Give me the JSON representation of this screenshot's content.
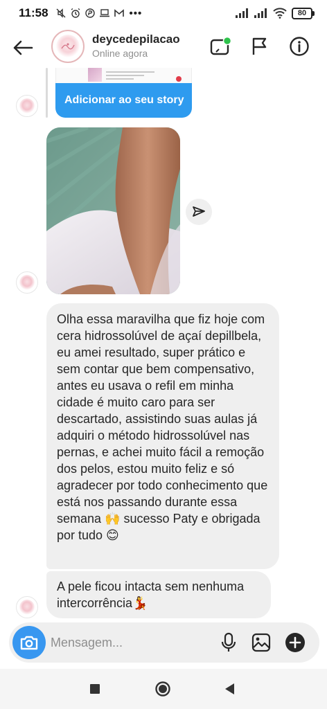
{
  "status_bar": {
    "time": "11:58",
    "overflow": "•••",
    "battery": "80"
  },
  "header": {
    "username": "deycedepilacao",
    "status": "Online agora",
    "icons": [
      "back-arrow-icon",
      "video-call-icon",
      "flag-icon",
      "info-icon"
    ]
  },
  "story_share": {
    "cta_label": "Adicionar ao seu story"
  },
  "messages": [
    {
      "type": "text",
      "text": "Olha essa maravilha que fiz hoje com cera hidrossolúvel de açaí depillbela, eu amei resultado, super prático e sem contar que bem compensativo, antes eu usava  o refil em minha cidade é muito caro para ser descartado, assistindo suas aulas já adquiri o método hidrossolúvel nas pernas, e achei muito fácil a remoção dos pelos, estou muito feliz e só agradecer por todo conhecimento que está nos passando durante essa semana 🙌 sucesso Paty e obrigada por tudo 😊"
    },
    {
      "type": "text",
      "text": "A pele ficou intacta sem nenhuma intercorrência💃"
    }
  ],
  "composer": {
    "placeholder": "Mensagem..."
  },
  "colors": {
    "accent_blue": "#3897f0",
    "story_button": "#2e9bef",
    "bubble": "#efefef",
    "online_dot": "#2ec24b"
  }
}
